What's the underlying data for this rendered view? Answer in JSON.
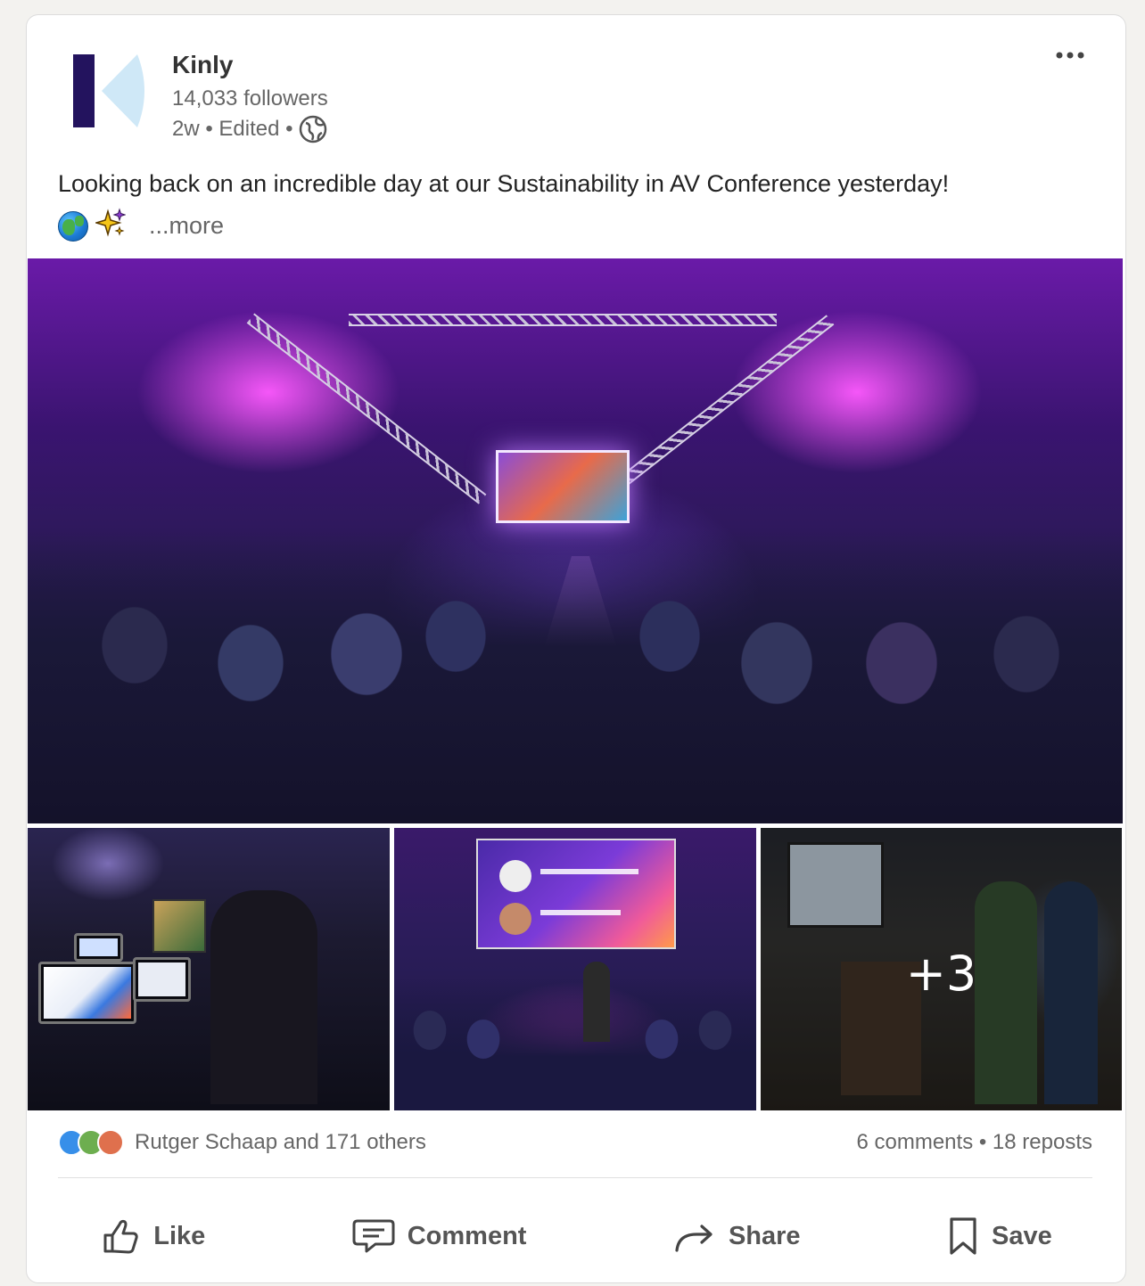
{
  "post": {
    "author": "Kinly",
    "followers": "14,033 followers",
    "meta": "2w • Edited •",
    "text": "Looking back on an incredible day at our Sustainability in AV Conference yesterday!",
    "more_link": "...more",
    "emojis": [
      "globe-earth-emoji",
      "sparkles-emoji"
    ]
  },
  "images": {
    "overflow_count": "+3"
  },
  "social": {
    "reactions_text": "Rutger Schaap and 171 others",
    "comments_reposts": "6 comments • 18 reposts",
    "reaction_icons": [
      "like-icon",
      "support-icon",
      "love-icon"
    ]
  },
  "actions": {
    "like": "Like",
    "comment": "Comment",
    "share": "Share",
    "save": "Save"
  },
  "colors": {
    "brand_navy": "#23135e",
    "brand_light_blue": "#cfe8f7",
    "text_secondary": "#666666"
  }
}
